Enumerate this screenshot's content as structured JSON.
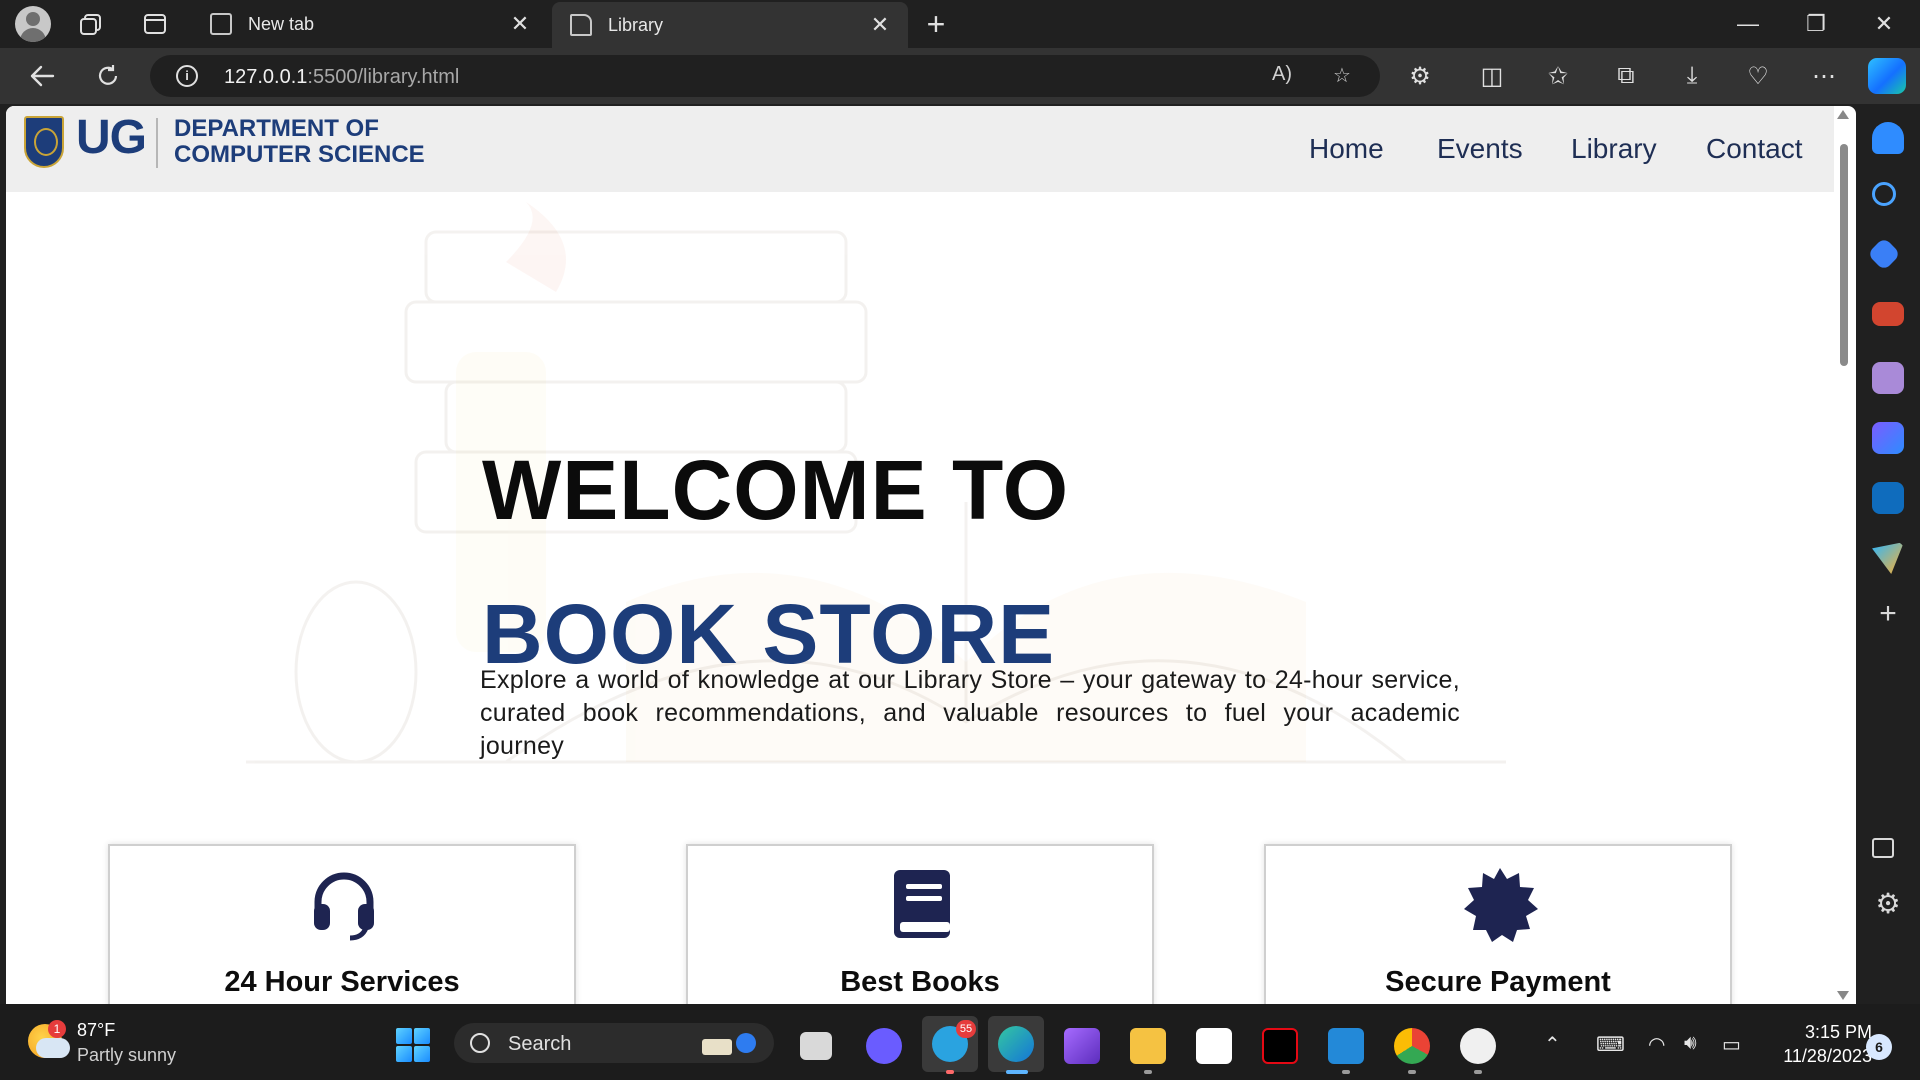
{
  "browser": {
    "tabs": [
      {
        "label": "New tab"
      },
      {
        "label": "Library"
      }
    ],
    "new_tab": "+",
    "address": {
      "host": "127.0.0.1",
      "path": ":5500/library.html"
    },
    "window_controls": {
      "minimize": "—",
      "restore": "❐",
      "close": "✕"
    }
  },
  "site": {
    "logo_text": "UG",
    "department_line1": "DEPARTMENT OF",
    "department_line2": "COMPUTER SCIENCE",
    "nav": [
      "Home",
      "Events",
      "Library",
      "Contact"
    ]
  },
  "hero": {
    "heading_line1": "WELCOME TO",
    "heading_line2": "BOOK STORE",
    "description": "Explore a world of knowledge at our Library Store – your gateway to 24-hour service, curated book recommendations, and valuable resources to fuel your academic journey"
  },
  "features": [
    {
      "title": "24 Hour Services",
      "icon": "headset-icon"
    },
    {
      "title": "Best Books",
      "icon": "book-icon"
    },
    {
      "title": "Secure Payment",
      "icon": "badge-icon"
    }
  ],
  "taskbar": {
    "weather_temp": "87°F",
    "weather_condition": "Partly sunny",
    "weather_badge": "1",
    "search_label": "Search",
    "telegram_badge": "55",
    "time": "3:15 PM",
    "date": "11/28/2023",
    "notifications": "6"
  },
  "colors": {
    "brand_blue": "#1d3d7a",
    "browser_dark": "#202020",
    "toolbar": "#333333"
  }
}
